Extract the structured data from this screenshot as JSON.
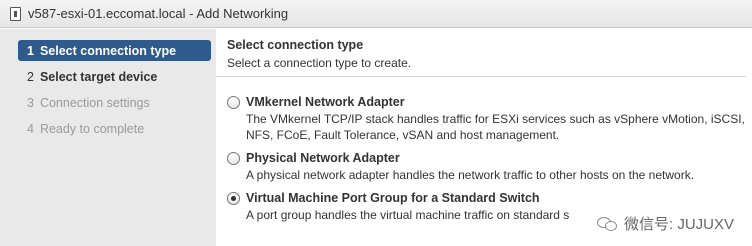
{
  "window": {
    "title": "v587-esxi-01.eccomat.local - Add Networking",
    "icon": "host-icon"
  },
  "steps": [
    {
      "num": "1",
      "label": "Select connection type",
      "state": "active"
    },
    {
      "num": "2",
      "label": "Select target device",
      "state": "enabled"
    },
    {
      "num": "3",
      "label": "Connection settings",
      "state": "disabled"
    },
    {
      "num": "4",
      "label": "Ready to complete",
      "state": "disabled"
    }
  ],
  "header": {
    "title": "Select connection type",
    "subtitle": "Select a connection type to create."
  },
  "options": [
    {
      "label": "VMkernel Network Adapter",
      "desc_lines": [
        "The VMkernel TCP/IP stack handles traffic for ESXi services such as vSphere vMotion, iSCSI,",
        "NFS, FCoE, Fault Tolerance, vSAN and host management."
      ],
      "checked": false
    },
    {
      "label": "Physical Network Adapter",
      "desc_lines": [
        "A physical network adapter handles the network traffic to other hosts on the network."
      ],
      "checked": false
    },
    {
      "label": "Virtual Machine Port Group for a Standard Switch",
      "desc_lines": [
        "A port group handles the virtual machine traffic on standard s"
      ],
      "checked": true
    }
  ],
  "watermark": {
    "text": "微信号: JUJUXV"
  },
  "colors": {
    "active_step_bg": "#2e5a8c",
    "sidebar_bg": "#e9e9e9"
  }
}
